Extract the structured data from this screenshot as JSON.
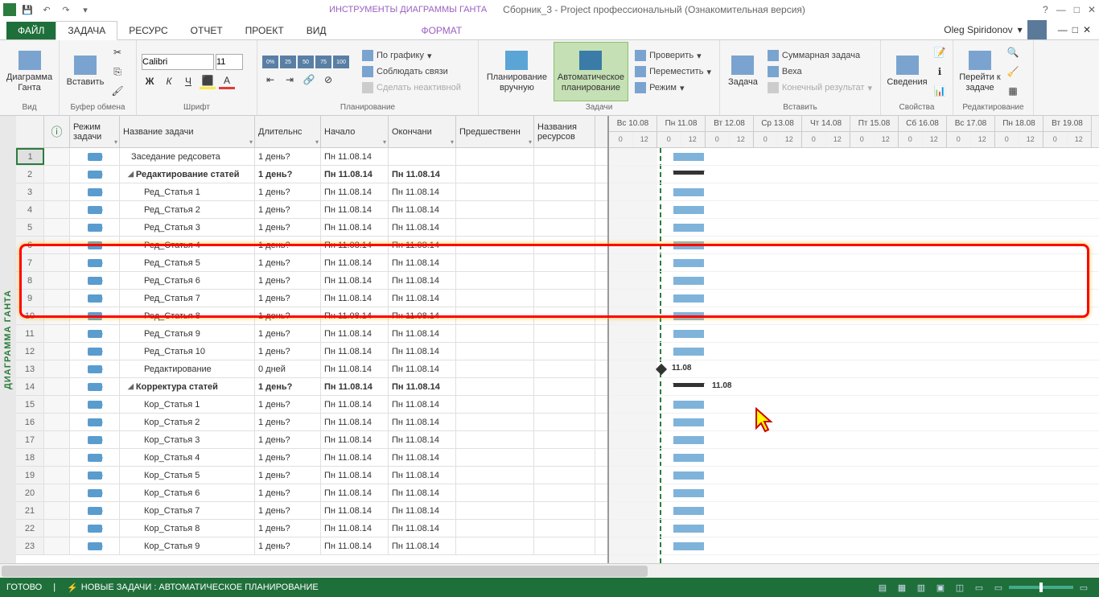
{
  "titlebar": {
    "gantt_tools": "ИНСТРУМЕНТЫ ДИАГРАММЫ ГАНТА",
    "doc_title": "Сборник_3 - Project профессиональный (Ознакомительная версия)"
  },
  "tabs": {
    "file": "ФАЙЛ",
    "task": "ЗАДАЧА",
    "resource": "РЕСУРС",
    "report": "ОТЧЕТ",
    "project": "ПРОЕКТ",
    "view": "ВИД",
    "format": "ФОРМАТ"
  },
  "user": "Oleg Spiridonov",
  "ribbon": {
    "view_group": "Вид",
    "gantt_chart": "Диаграмма Ганта",
    "clipboard": "Буфер обмена",
    "paste": "Вставить",
    "font_group": "Шрифт",
    "font_name": "Calibri",
    "font_size": "11",
    "planning_group": "Планирование",
    "by_schedule": "По графику",
    "respect_links": "Соблюдать связи",
    "make_inactive": "Сделать неактивной",
    "manual_plan": "Планирование вручную",
    "auto_plan": "Автоматическое планирование",
    "tasks_group": "Задачи",
    "check": "Проверить",
    "move": "Переместить",
    "mode": "Режим",
    "insert_group": "Вставить",
    "task_btn": "Задача",
    "summary_task": "Суммарная задача",
    "milestone": "Веха",
    "deliverable": "Конечный результат",
    "properties_group": "Свойства",
    "details": "Сведения",
    "editing_group": "Редактирование",
    "scroll_to": "Перейти к задаче"
  },
  "columns": {
    "info": "ⓘ",
    "mode": "Режим задачи",
    "name": "Название задачи",
    "duration": "Длительнс",
    "start": "Начало",
    "finish": "Окончани",
    "predecessors": "Предшественн",
    "resources": "Названия ресурсов"
  },
  "timeline": {
    "days": [
      "Вс 10.08",
      "Пн 11.08",
      "Вт 12.08",
      "Ср 13.08",
      "Чт 14.08",
      "Пт 15.08",
      "Сб 16.08",
      "Вс 17.08",
      "Пн 18.08",
      "Вт 19.08"
    ],
    "hours": [
      "0",
      "12"
    ]
  },
  "rows": [
    {
      "id": "1",
      "name": "Заседание редсовета",
      "dur": "1 день?",
      "start": "Пн 11.08.14",
      "end": "",
      "indent": 0,
      "bold": false,
      "sel": true
    },
    {
      "id": "2",
      "name": "Редактирование статей",
      "dur": "1 день?",
      "start": "Пн 11.08.14",
      "end": "Пн 11.08.14",
      "indent": 0,
      "bold": true,
      "summary": true
    },
    {
      "id": "3",
      "name": "Ред_Статья 1",
      "dur": "1 день?",
      "start": "Пн 11.08.14",
      "end": "Пн 11.08.14",
      "indent": 1
    },
    {
      "id": "4",
      "name": "Ред_Статья 2",
      "dur": "1 день?",
      "start": "Пн 11.08.14",
      "end": "Пн 11.08.14",
      "indent": 1
    },
    {
      "id": "5",
      "name": "Ред_Статья 3",
      "dur": "1 день?",
      "start": "Пн 11.08.14",
      "end": "Пн 11.08.14",
      "indent": 1
    },
    {
      "id": "6",
      "name": "Ред_Статья 4",
      "dur": "1 день?",
      "start": "Пн 11.08.14",
      "end": "Пн 11.08.14",
      "indent": 1
    },
    {
      "id": "7",
      "name": "Ред_Статья 5",
      "dur": "1 день?",
      "start": "Пн 11.08.14",
      "end": "Пн 11.08.14",
      "indent": 1
    },
    {
      "id": "8",
      "name": "Ред_Статья 6",
      "dur": "1 день?",
      "start": "Пн 11.08.14",
      "end": "Пн 11.08.14",
      "indent": 1
    },
    {
      "id": "9",
      "name": "Ред_Статья 7",
      "dur": "1 день?",
      "start": "Пн 11.08.14",
      "end": "Пн 11.08.14",
      "indent": 1
    },
    {
      "id": "10",
      "name": "Ред_Статья 8",
      "dur": "1 день?",
      "start": "Пн 11.08.14",
      "end": "Пн 11.08.14",
      "indent": 1
    },
    {
      "id": "11",
      "name": "Ред_Статья 9",
      "dur": "1 день?",
      "start": "Пн 11.08.14",
      "end": "Пн 11.08.14",
      "indent": 1
    },
    {
      "id": "12",
      "name": "Ред_Статья 10",
      "dur": "1 день?",
      "start": "Пн 11.08.14",
      "end": "Пн 11.08.14",
      "indent": 1
    },
    {
      "id": "13",
      "name": "Редактирование",
      "dur": "0 дней",
      "start": "Пн 11.08.14",
      "end": "Пн 11.08.14",
      "indent": 1,
      "milestone": true,
      "mslabel": "11.08"
    },
    {
      "id": "14",
      "name": "Корректура статей",
      "dur": "1 день?",
      "start": "Пн 11.08.14",
      "end": "Пн 11.08.14",
      "indent": 0,
      "bold": true,
      "summary": true,
      "mslabel": "11.08"
    },
    {
      "id": "15",
      "name": "Кор_Статья 1",
      "dur": "1 день?",
      "start": "Пн 11.08.14",
      "end": "Пн 11.08.14",
      "indent": 1
    },
    {
      "id": "16",
      "name": "Кор_Статья 2",
      "dur": "1 день?",
      "start": "Пн 11.08.14",
      "end": "Пн 11.08.14",
      "indent": 1
    },
    {
      "id": "17",
      "name": "Кор_Статья 3",
      "dur": "1 день?",
      "start": "Пн 11.08.14",
      "end": "Пн 11.08.14",
      "indent": 1
    },
    {
      "id": "18",
      "name": "Кор_Статья 4",
      "dur": "1 день?",
      "start": "Пн 11.08.14",
      "end": "Пн 11.08.14",
      "indent": 1
    },
    {
      "id": "19",
      "name": "Кор_Статья 5",
      "dur": "1 день?",
      "start": "Пн 11.08.14",
      "end": "Пн 11.08.14",
      "indent": 1
    },
    {
      "id": "20",
      "name": "Кор_Статья 6",
      "dur": "1 день?",
      "start": "Пн 11.08.14",
      "end": "Пн 11.08.14",
      "indent": 1
    },
    {
      "id": "21",
      "name": "Кор_Статья 7",
      "dur": "1 день?",
      "start": "Пн 11.08.14",
      "end": "Пн 11.08.14",
      "indent": 1
    },
    {
      "id": "22",
      "name": "Кор_Статья 8",
      "dur": "1 день?",
      "start": "Пн 11.08.14",
      "end": "Пн 11.08.14",
      "indent": 1
    },
    {
      "id": "23",
      "name": "Кор_Статья 9",
      "dur": "1 день?",
      "start": "Пн 11.08.14",
      "end": "Пн 11.08.14",
      "indent": 1
    }
  ],
  "statusbar": {
    "ready": "ГОТОВО",
    "new_tasks": "НОВЫЕ ЗАДАЧИ : АВТОМАТИЧЕСКОЕ ПЛАНИРОВАНИЕ"
  },
  "side_label": "ДИАГРАММА ГАНТА"
}
